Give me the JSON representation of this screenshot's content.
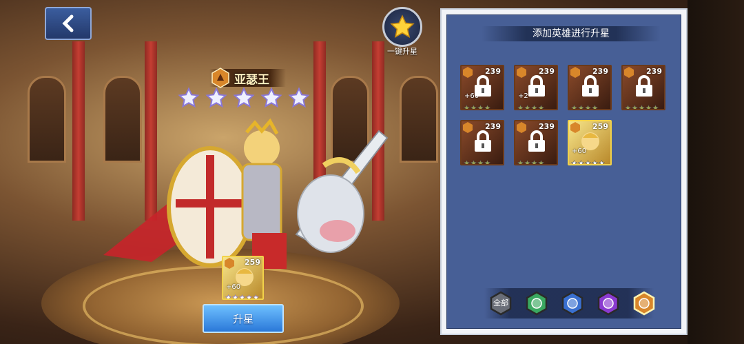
{
  "hero": {
    "name": "亚瑟王",
    "stars": 5,
    "card": {
      "level": "259",
      "bonus": "+60",
      "stars": 5
    }
  },
  "buttons": {
    "one_key_label": "一键升星",
    "upgrade_label": "升星"
  },
  "panel": {
    "title": "添加英雄进行升星",
    "slots": [
      {
        "level": "239",
        "locked": true,
        "bonus": "+60",
        "frame": "brown",
        "stars": 4
      },
      {
        "level": "239",
        "locked": true,
        "bonus": "+2",
        "frame": "brown",
        "stars": 4
      },
      {
        "level": "239",
        "locked": true,
        "bonus": "",
        "frame": "brown",
        "stars": 4
      },
      {
        "level": "239",
        "locked": true,
        "bonus": "",
        "frame": "brown",
        "stars": 5
      },
      {
        "level": "239",
        "locked": true,
        "bonus": "",
        "frame": "brown",
        "stars": 4
      },
      {
        "level": "239",
        "locked": true,
        "bonus": "",
        "frame": "brown",
        "stars": 4
      },
      {
        "level": "259",
        "locked": false,
        "bonus": "+60",
        "frame": "gold",
        "stars": 5
      }
    ],
    "filters": [
      {
        "label": "全部",
        "icon": "all-filter",
        "color": "#6a6e78"
      },
      {
        "label": "",
        "icon": "nature-faction-icon",
        "color": "#3aa860"
      },
      {
        "label": "",
        "icon": "water-faction-icon",
        "color": "#3a70d0"
      },
      {
        "label": "",
        "icon": "dark-faction-icon",
        "color": "#8a3ad0"
      },
      {
        "label": "",
        "icon": "fire-faction-icon",
        "color": "#d8862a",
        "selected": true
      }
    ]
  },
  "colors": {
    "accent_blue": "#2a78d8",
    "panel_bg": "#475f96",
    "gold": "#f2d24a"
  }
}
